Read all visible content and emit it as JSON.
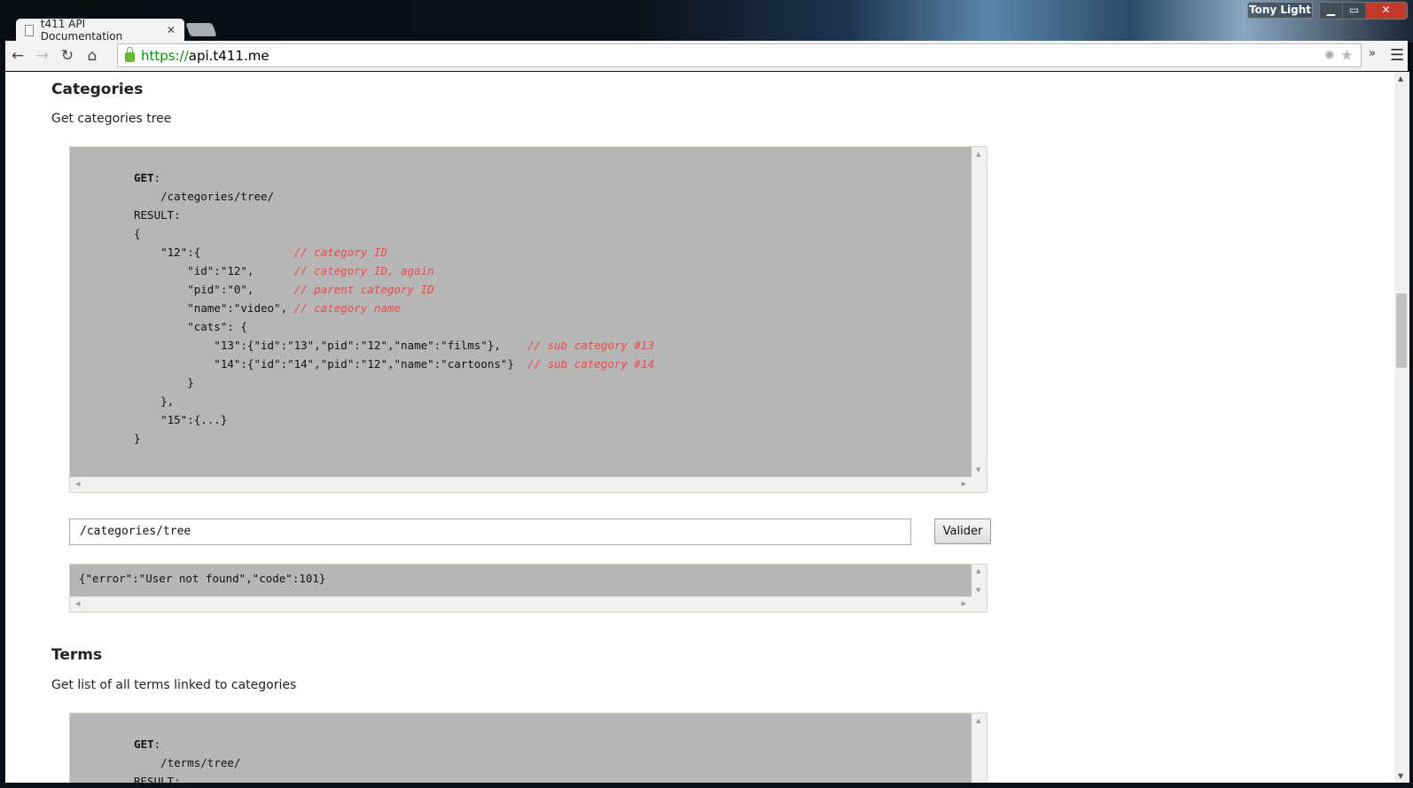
{
  "browser": {
    "tab_title": "t411 API Documentation",
    "url_scheme": "https://",
    "url_host": "api.t411.me",
    "user": "Tony Light",
    "window_controls": {
      "minimize": "▁",
      "maximize": "▭",
      "close": "✕"
    }
  },
  "sections": [
    {
      "title": "Categories",
      "description": "Get categories tree",
      "code": {
        "method": "GET",
        "path": "/categories/tree/",
        "result_label": "RESULT",
        "lines": [
          {
            "code": "{",
            "comment": ""
          },
          {
            "code": "    \"12\":{              ",
            "comment": "// category ID"
          },
          {
            "code": "        \"id\":\"12\",      ",
            "comment": "// category ID, again"
          },
          {
            "code": "        \"pid\":\"0\",      ",
            "comment": "// parent category ID"
          },
          {
            "code": "        \"name\":\"video\", ",
            "comment": "// category name"
          },
          {
            "code": "        \"cats\": {",
            "comment": ""
          },
          {
            "code": "            \"13\":{\"id\":\"13\",\"pid\":\"12\",\"name\":\"films\"},    ",
            "comment": "// sub category #13"
          },
          {
            "code": "            \"14\":{\"id\":\"14\",\"pid\":\"12\",\"name\":\"cartoons\"}  ",
            "comment": "// sub category #14"
          },
          {
            "code": "        }",
            "comment": ""
          },
          {
            "code": "    },",
            "comment": ""
          },
          {
            "code": "    \"15\":{...}",
            "comment": ""
          },
          {
            "code": "}",
            "comment": ""
          }
        ]
      },
      "test_input": "/categories/tree",
      "submit_label": "Valider",
      "response": "{\"error\":\"User not found\",\"code\":101}"
    },
    {
      "title": "Terms",
      "description": "Get list of all terms linked to categories",
      "code": {
        "method": "GET",
        "path": "/terms/tree/",
        "result_label": "RESULT"
      }
    }
  ]
}
